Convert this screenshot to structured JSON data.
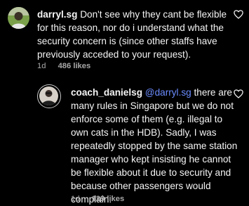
{
  "comments": [
    {
      "username": "darryl.sg",
      "text": "Don't see why they cant be flexible for this reason, nor do i understand what the security concern is (since other staffs have previously acceded to your request).",
      "time": "1d",
      "likes": "486 likes",
      "avatar_icon": "avatar-photo-person",
      "heart_icon": "heart-outline-icon"
    },
    {
      "username": "coach_danielsg",
      "mention": "@darryl.sg",
      "text": "there are many rules in Singapore but we do not enforce some of them (e.g. illegal to own cats in the HDB). Sadly, I was repeatedly stopped by the same station manager who kept insisting he cannot be flexible about it due to security and because other passengers would complain.",
      "time": "1d",
      "likes": "129 likes",
      "avatar_icon": "avatar-photo-person-with-story-ring",
      "heart_icon": "heart-outline-icon"
    }
  ],
  "colors": {
    "background": "#000000",
    "text": "#f5f5f5",
    "meta": "#a8a8a8",
    "mention": "#6b8cff",
    "story_ring": "#c9c9c9"
  }
}
